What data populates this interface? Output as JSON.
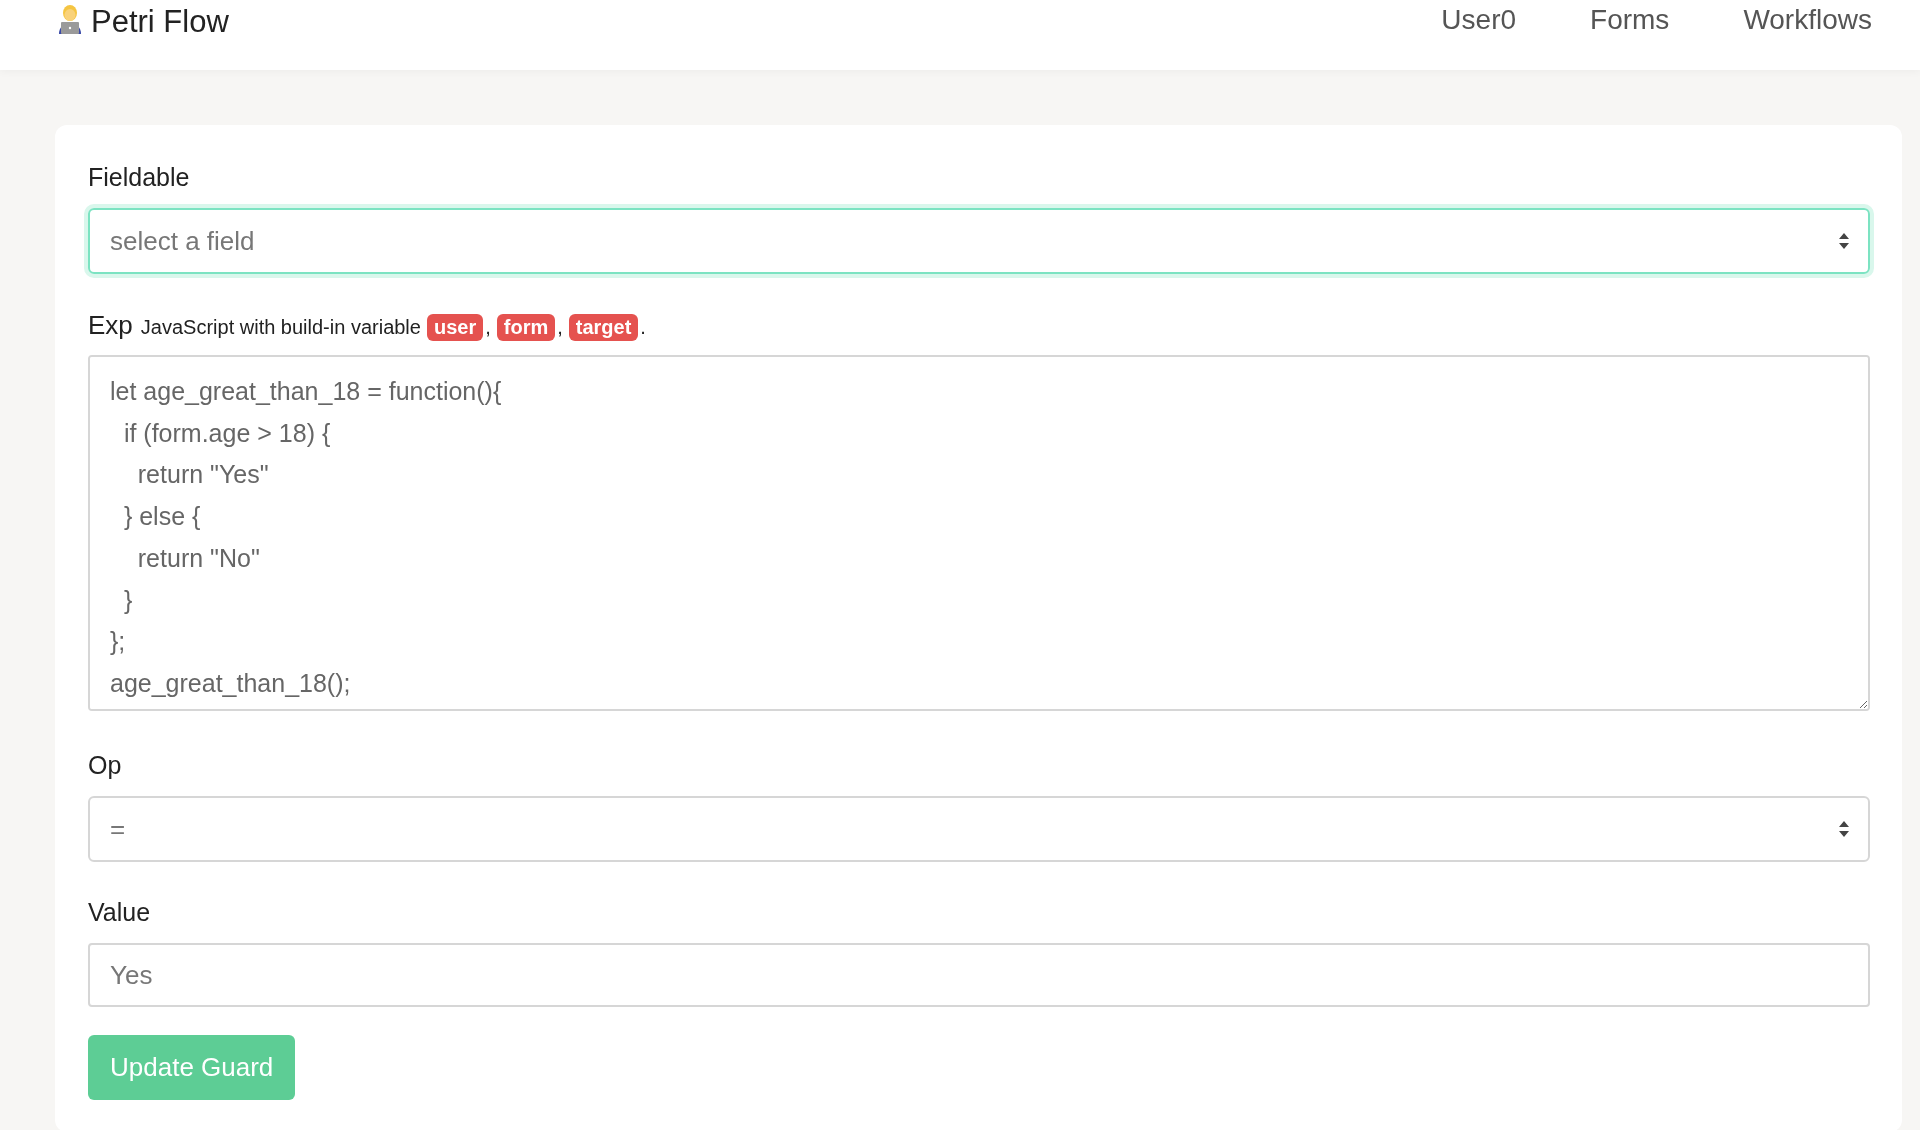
{
  "navbar": {
    "brand": "Petri Flow",
    "links": [
      {
        "label": "User0"
      },
      {
        "label": "Forms"
      },
      {
        "label": "Workflows"
      }
    ]
  },
  "form": {
    "fieldable": {
      "label": "Fieldable",
      "placeholder": "select a field",
      "focused": true
    },
    "exp": {
      "label": "Exp",
      "hint": "JavaScript with build-in variable",
      "variables": [
        {
          "name": "user",
          "after": ","
        },
        {
          "name": "form",
          "after": ","
        },
        {
          "name": "target",
          "after": "."
        }
      ],
      "value": "let age_great_than_18 = function(){\n  if (form.age > 18) {\n    return \"Yes\"\n  } else {\n    return \"No\"\n  }\n};\nage_great_than_18();"
    },
    "op": {
      "label": "Op",
      "value": "=",
      "focused": false
    },
    "value": {
      "label": "Value",
      "placeholder": "Yes"
    },
    "button": "Update Guard"
  }
}
